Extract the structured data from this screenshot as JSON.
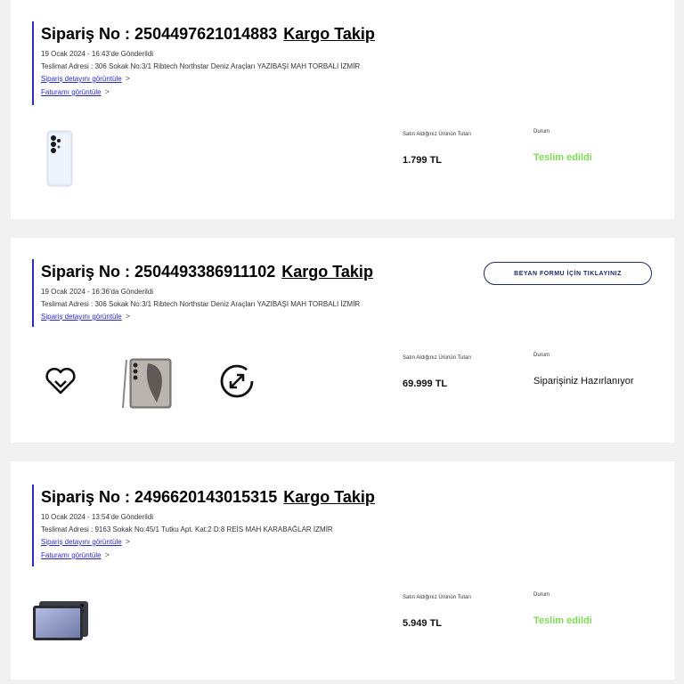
{
  "labels": {
    "order_prefix": "Sipariş No :",
    "track": "Kargo Takip",
    "view_order_details": "Sipariş detayını görüntüle",
    "view_invoice": "Faturamı görüntüle",
    "price_label": "Satın Aldığınız Ürünün Tutarı",
    "status_label": "Durum",
    "declaration_button": "BEYAN FORMU İÇİN TIKLAYINIZ"
  },
  "colors": {
    "delivered": "#7ed957",
    "accent": "#2b2bbf",
    "button_border": "#1f2a6a"
  },
  "orders": [
    {
      "order_number": "2504497621014883",
      "sent_date": "19 Ocak 2024 - 16:43'de Gönderildi",
      "address": "Teslimat Adresi : 306 Sokak No:3/1 Ribtech Northstar Deniz Araçları YAZIBAŞI MAH TORBALI İZMİR",
      "price": "1.799 TL",
      "status": "Teslim edildi",
      "products": [
        "phone-case-image"
      ]
    },
    {
      "order_number": "2504493386911102",
      "sent_date": "19 Ocak 2024 - 16:36'da Gönderildi",
      "address": "Teslimat Adresi : 306 Sokak No:3/1 Ribtech Northstar Deniz Araçları YAZIBAŞI MAH TORBALI İZMİR",
      "price": "69.999 TL",
      "status": "Siparişiniz Hazırlanıyor",
      "products": [
        "care-heart-icon",
        "galaxy-s24-ultra-image",
        "trade-in-exchange-icon"
      ]
    },
    {
      "order_number": "2496620143015315",
      "sent_date": "10 Ocak 2024 - 13:54'de Gönderildi",
      "address": "Teslimat Adresi : 9163 Sokak No:45/1 Tutku Apt. Kat:2 D:8 REİS MAH KARABAĞLAR İZMİR",
      "price": "5.949 TL",
      "status": "Teslim edildi",
      "products": [
        "galaxy-tab-image"
      ]
    }
  ]
}
